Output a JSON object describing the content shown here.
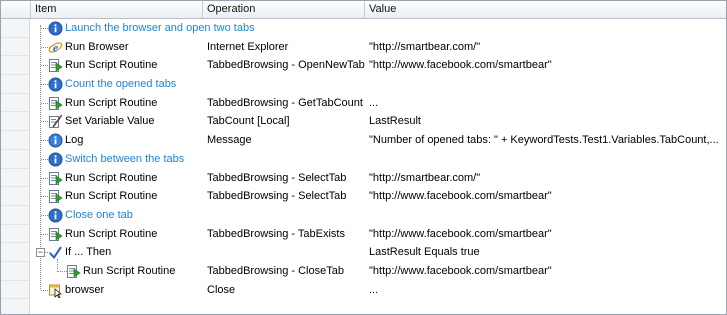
{
  "columns": {
    "item": "Item",
    "operation": "Operation",
    "value": "Value"
  },
  "rows": [
    {
      "type": "comment",
      "icon": "info-icon",
      "item": "Launch the browser and open two tabs",
      "operation": "",
      "value": ""
    },
    {
      "type": "op",
      "icon": "internet-explorer-icon",
      "item": "Run Browser",
      "operation": "Internet Explorer",
      "value": "\"http://smartbear.com/\""
    },
    {
      "type": "op",
      "icon": "run-script-icon",
      "item": "Run Script Routine",
      "operation": "TabbedBrowsing - OpenNewTab",
      "value": "\"http://www.facebook.com/smartbear\""
    },
    {
      "type": "comment",
      "icon": "info-icon",
      "item": "Count the opened tabs",
      "operation": "",
      "value": ""
    },
    {
      "type": "op",
      "icon": "run-script-icon",
      "item": "Run Script Routine",
      "operation": "TabbedBrowsing - GetTabCount",
      "value": "..."
    },
    {
      "type": "op",
      "icon": "set-variable-icon",
      "item": "Set Variable Value",
      "operation": "TabCount [Local]",
      "value": "LastResult"
    },
    {
      "type": "op",
      "icon": "log-icon",
      "item": "Log",
      "operation": "Message",
      "value": "\"Number of opened tabs: \" + KeywordTests.Test1.Variables.TabCount,..."
    },
    {
      "type": "comment",
      "icon": "info-icon",
      "item": "Switch between the tabs",
      "operation": "",
      "value": ""
    },
    {
      "type": "op",
      "icon": "run-script-icon",
      "item": "Run Script Routine",
      "operation": "TabbedBrowsing - SelectTab",
      "value": "\"http://smartbear.com/\""
    },
    {
      "type": "op",
      "icon": "run-script-icon",
      "item": "Run Script Routine",
      "operation": "TabbedBrowsing - SelectTab",
      "value": "\"http://www.facebook.com/smartbear\""
    },
    {
      "type": "comment",
      "icon": "info-icon",
      "item": "Close one tab",
      "operation": "",
      "value": ""
    },
    {
      "type": "op",
      "icon": "run-script-icon",
      "item": "Run Script Routine",
      "operation": "TabbedBrowsing - TabExists",
      "value": "\"http://www.facebook.com/smartbear\""
    },
    {
      "type": "if",
      "icon": "checkmark-icon",
      "item": "If ... Then",
      "operation": "",
      "value": "LastResult Equals true"
    },
    {
      "type": "child",
      "icon": "run-script-icon",
      "item": "Run Script Routine",
      "operation": "TabbedBrowsing - CloseTab",
      "value": "\"http://www.facebook.com/smartbear\""
    },
    {
      "type": "op",
      "icon": "browser-icon",
      "item": "browser",
      "operation": "Close",
      "value": "..."
    }
  ],
  "colors": {
    "comment_text": "#1f86d6",
    "header_bg": "#eceef1"
  }
}
